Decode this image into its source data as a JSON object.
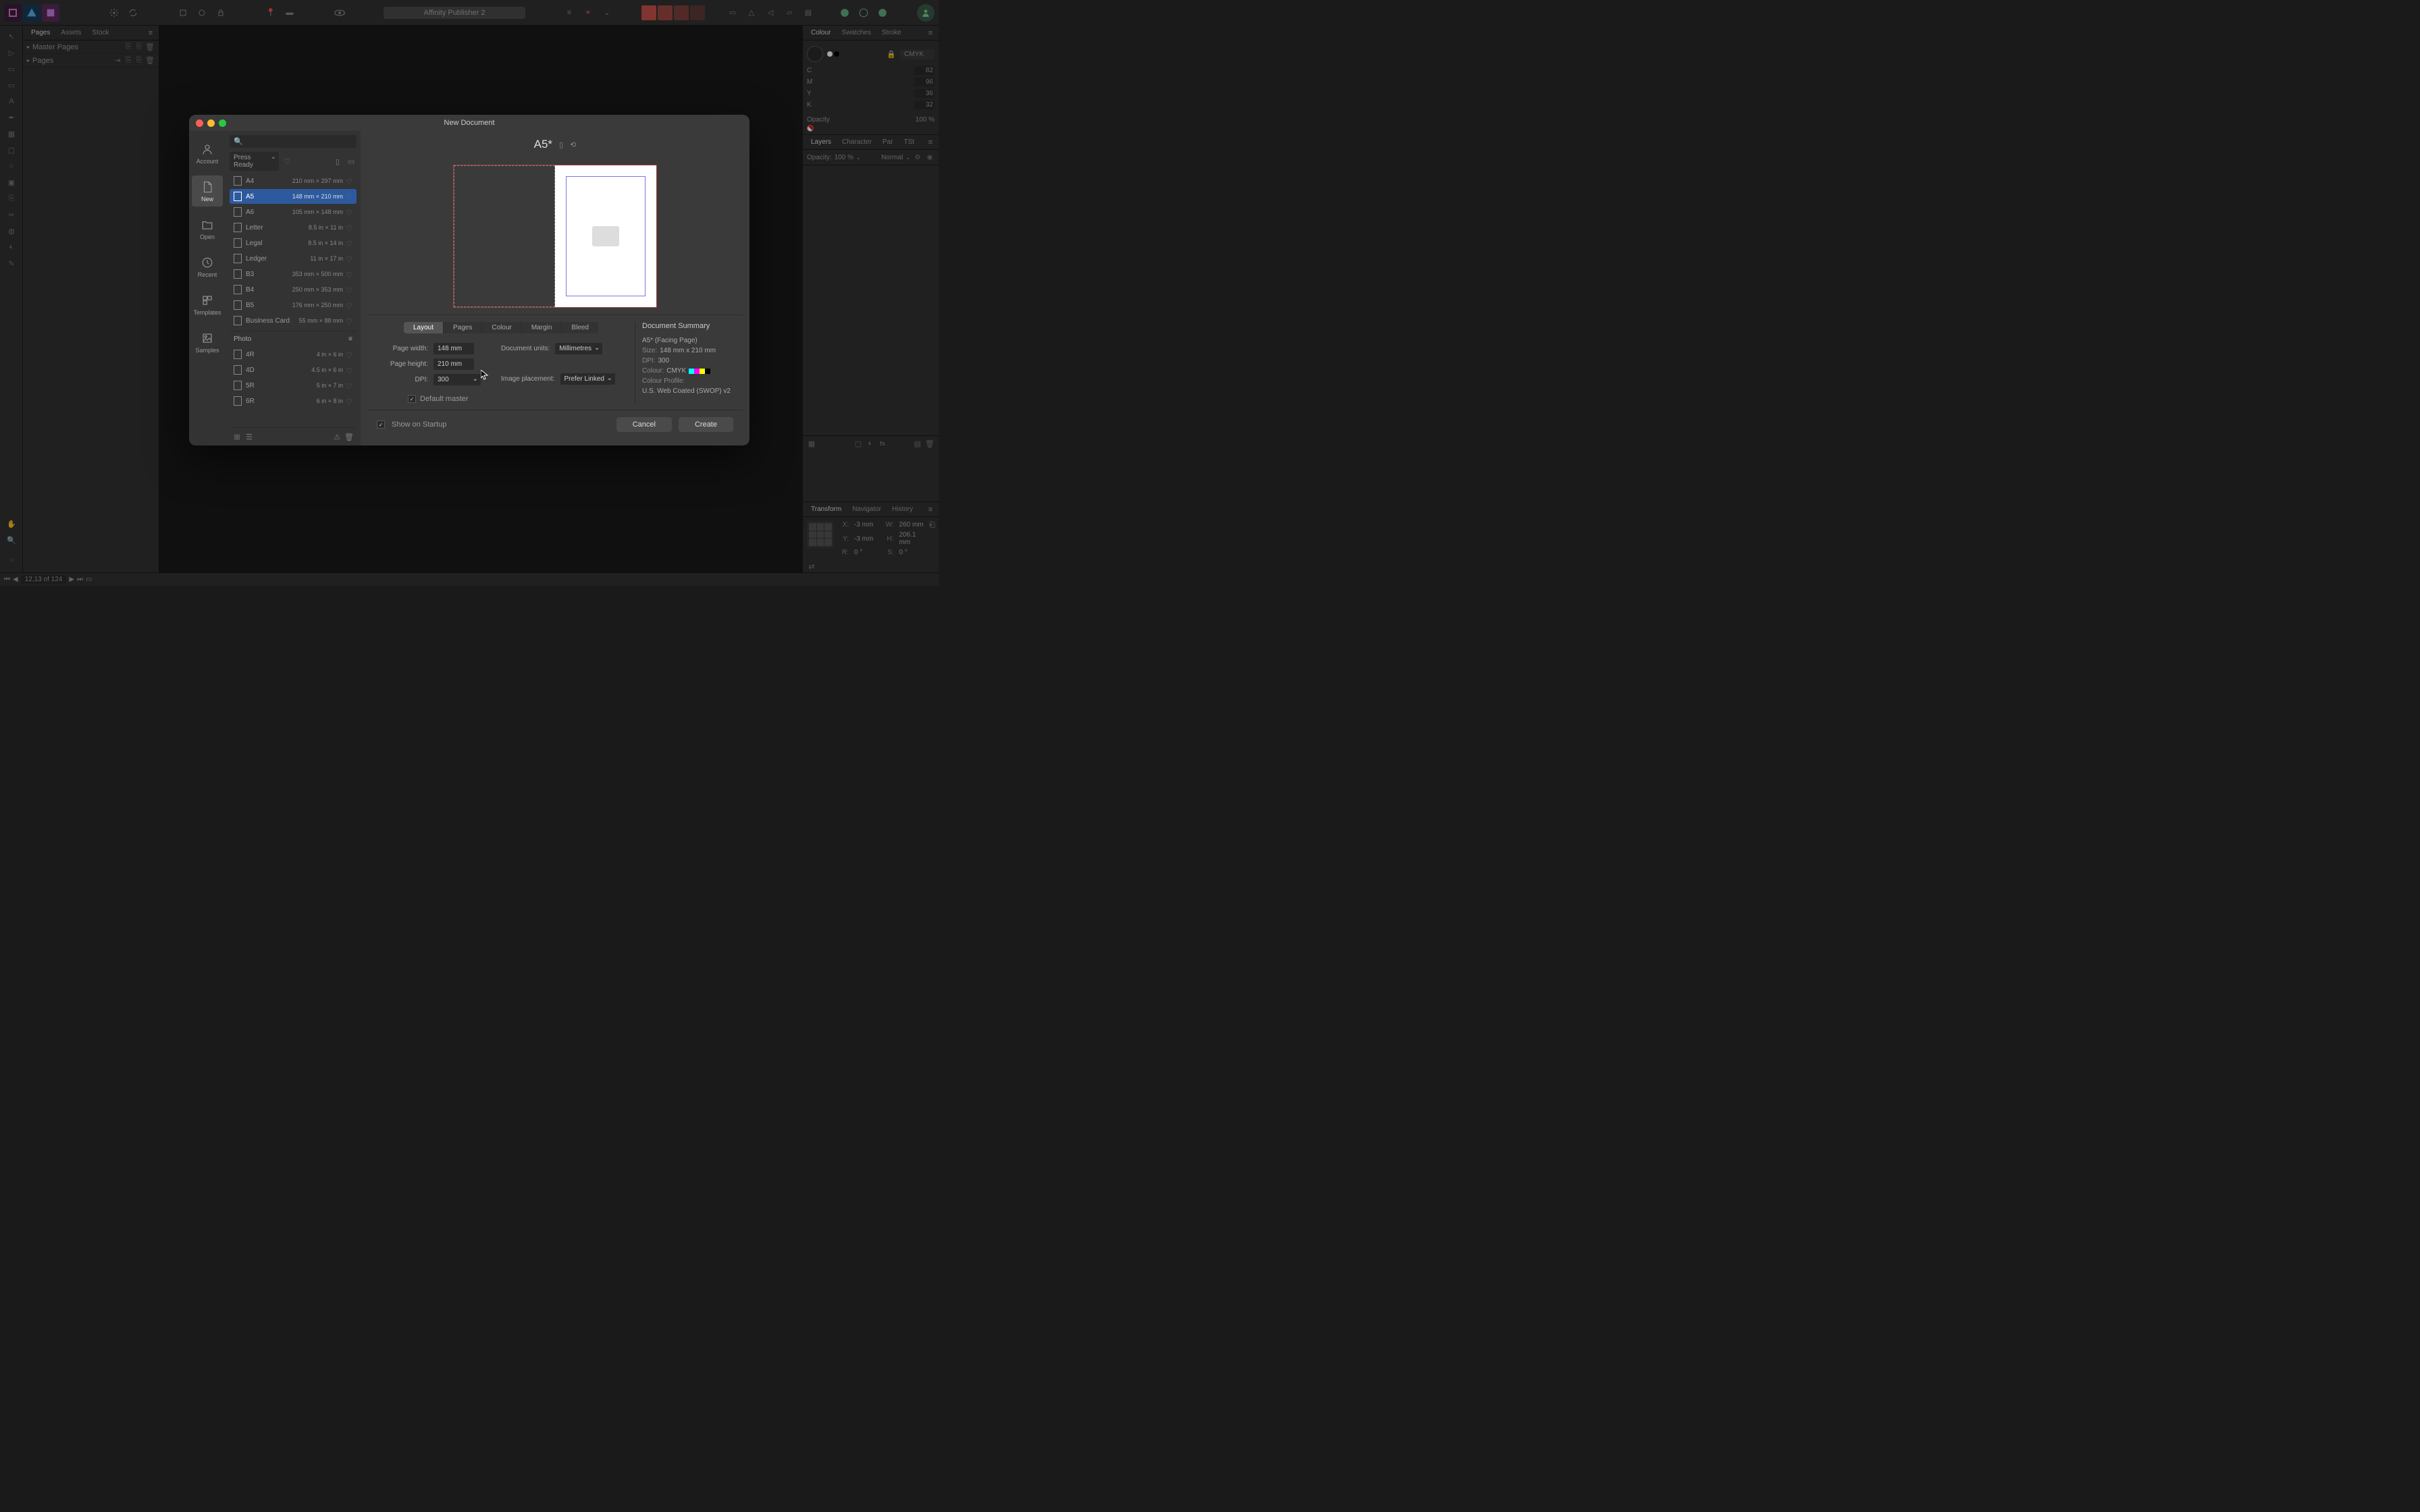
{
  "app": {
    "title": "Affinity Publisher 2"
  },
  "left_panel": {
    "tabs": [
      "Pages",
      "Assets",
      "Stock"
    ],
    "master_pages": "Master Pages",
    "pages": "Pages"
  },
  "right_panel": {
    "colour_tabs": [
      "Colour",
      "Swatches",
      "Stroke"
    ],
    "colour_mode": "CMYK",
    "channels": [
      {
        "label": "C",
        "value": "82"
      },
      {
        "label": "M",
        "value": "96"
      },
      {
        "label": "Y",
        "value": "36"
      },
      {
        "label": "K",
        "value": "32"
      }
    ],
    "opacity_label": "Opacity",
    "opacity_value": "100 %",
    "layers_tabs": [
      "Layers",
      "Character",
      "Par",
      "TSt"
    ],
    "layers_opacity_label": "Opacity:",
    "layers_opacity_value": "100 %",
    "blend_mode": "Normal",
    "transform_tabs": [
      "Transform",
      "Navigator",
      "History"
    ],
    "transform": {
      "x_label": "X:",
      "x_value": "-3 mm",
      "y_label": "Y:",
      "y_value": "-3 mm",
      "w_label": "W:",
      "w_value": "260 mm",
      "h_label": "H:",
      "h_value": "206.1 mm",
      "r_label": "R:",
      "r_value": "0 °",
      "s_label": "S:",
      "s_value": "0 °"
    }
  },
  "bottom_bar": {
    "page_indicator": "12,13 of 124"
  },
  "modal": {
    "title": "New Document",
    "sidebar": [
      {
        "id": "account",
        "label": "Account"
      },
      {
        "id": "new",
        "label": "New"
      },
      {
        "id": "open",
        "label": "Open"
      },
      {
        "id": "recent",
        "label": "Recent"
      },
      {
        "id": "templates",
        "label": "Templates"
      },
      {
        "id": "samples",
        "label": "Samples"
      }
    ],
    "search_placeholder": "",
    "category": "Press Ready",
    "presets": [
      {
        "name": "A4",
        "dims": "210 mm × 297 mm"
      },
      {
        "name": "A5",
        "dims": "148 mm × 210 mm"
      },
      {
        "name": "A6",
        "dims": "105 mm × 148 mm"
      },
      {
        "name": "Letter",
        "dims": "8.5 in × 11 in"
      },
      {
        "name": "Legal",
        "dims": "8.5 in × 14 in"
      },
      {
        "name": "Ledger",
        "dims": "11 in × 17 in"
      },
      {
        "name": "B3",
        "dims": "353 mm × 500 mm"
      },
      {
        "name": "B4",
        "dims": "250 mm × 353 mm"
      },
      {
        "name": "B5",
        "dims": "176 mm × 250 mm"
      },
      {
        "name": "Business Card",
        "dims": "55 mm × 88 mm"
      }
    ],
    "photo_section": "Photo",
    "photo_presets": [
      {
        "name": "4R",
        "dims": "4 in × 6 in"
      },
      {
        "name": "4D",
        "dims": "4.5 in × 6 in"
      },
      {
        "name": "5R",
        "dims": "5 in × 7 in"
      },
      {
        "name": "6R",
        "dims": "6 in × 8 in"
      }
    ],
    "selected_preset": "A5",
    "preview_title": "A5*",
    "settings_tabs": [
      "Layout",
      "Pages",
      "Colour",
      "Margin",
      "Bleed"
    ],
    "active_settings_tab": "Layout",
    "layout": {
      "page_width_label": "Page width:",
      "page_width_value": "148 mm",
      "page_height_label": "Page height:",
      "page_height_value": "210 mm",
      "dpi_label": "DPI:",
      "dpi_value": "300",
      "doc_units_label": "Document units:",
      "doc_units_value": "Millimetres",
      "image_placement_label": "Image placement:",
      "image_placement_value": "Prefer Linked",
      "default_master_label": "Default master"
    },
    "summary": {
      "title": "Document Summary",
      "name": "A5* (Facing Page)",
      "size_label": "Size:",
      "size_value": "148 mm x 210 mm",
      "dpi_label": "DPI:",
      "dpi_value": "300",
      "colour_label": "Colour:",
      "colour_value": "CMYK",
      "profile_label": "Colour Profile:",
      "profile_value": "U.S. Web Coated (SWOP) v2"
    },
    "show_on_startup": "Show on Startup",
    "cancel": "Cancel",
    "create": "Create"
  }
}
